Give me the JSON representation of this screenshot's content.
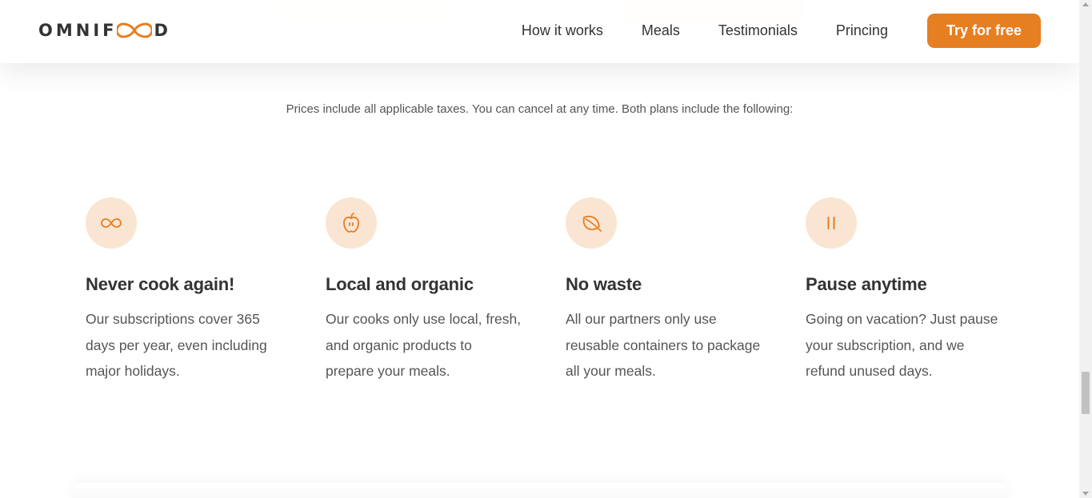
{
  "colors": {
    "accent": "#e67e22",
    "icon_bg": "#fae5d3",
    "heading": "#333333",
    "text": "#555555"
  },
  "header": {
    "logo_text_left": "OMNIF",
    "logo_text_right": "D",
    "logo_icon": "infinity-icon",
    "nav": [
      {
        "label": "How it works"
      },
      {
        "label": "Meals"
      },
      {
        "label": "Testimonials"
      },
      {
        "label": "Princing"
      }
    ],
    "cta_label": "Try for free"
  },
  "pricing_note": "Prices include all applicable taxes. You can cancel at any time. Both plans include the following:",
  "features": [
    {
      "icon": "infinity-icon",
      "title": "Never cook again!",
      "text": "Our subscriptions cover 365 days per year, even including major holidays."
    },
    {
      "icon": "apple-icon",
      "title": "Local and organic",
      "text": "Our cooks only use local, fresh, and organic products to prepare your meals."
    },
    {
      "icon": "leaf-icon",
      "title": "No waste",
      "text": "All our partners only use reusable containers to package all your meals."
    },
    {
      "icon": "pause-icon",
      "title": "Pause anytime",
      "text": "Going on vacation? Just pause your subscription, and we refund unused days."
    }
  ]
}
